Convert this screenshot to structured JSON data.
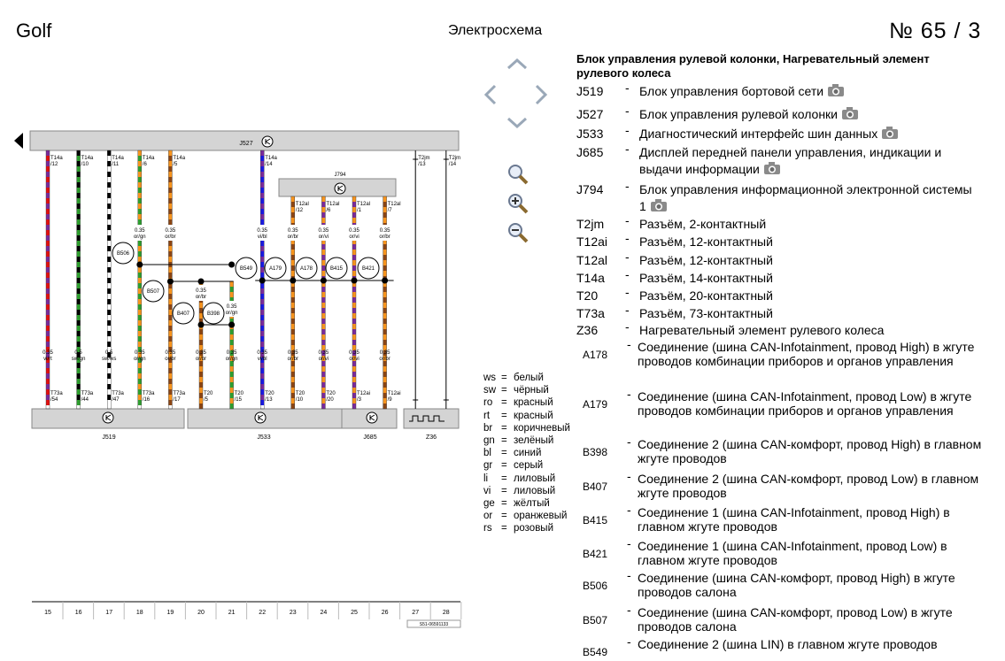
{
  "header": {
    "brand": "Golf",
    "doc_type": "Электросхема",
    "page_number": "№  65 / 3"
  },
  "title": "Блок управления рулевой колонки, Нагревательный элемент рулевого колеса",
  "components": [
    {
      "code": "J519",
      "desc": "Блок управления бортовой сети",
      "photo": true
    },
    {
      "code": "J527",
      "desc": "Блок управления рулевой колонки",
      "photo": true
    },
    {
      "code": "J533",
      "desc": "Диагностический интерфейс шин данных",
      "photo": true
    },
    {
      "code": "J685",
      "desc": "Дисплей передней панели управления, индикации и выдачи информации",
      "photo": true
    },
    {
      "code": "J794",
      "desc": "Блок управления информационной электронной системы 1",
      "photo": true
    },
    {
      "code": "T2jm",
      "desc": "Разъём, 2-контактный"
    },
    {
      "code": "T12ai",
      "desc": "Разъём, 12-контактный"
    },
    {
      "code": "T12al",
      "desc": "Разъём, 12-контактный"
    },
    {
      "code": "T14a",
      "desc": "Разъём, 14-контактный"
    },
    {
      "code": "T20",
      "desc": "Разъём, 20-контактный"
    },
    {
      "code": "T73a",
      "desc": "Разъём, 73-контактный"
    },
    {
      "code": "Z36",
      "desc": "Нагревательный элемент рулевого колеса"
    }
  ],
  "connections": [
    {
      "code": "A178",
      "desc": "Соединение (шина CAN-Infotainment, провод High) в жгуте проводов комбинации приборов и органов управления"
    },
    {
      "code": "A179",
      "desc": "Соединение (шина CAN-Infotainment, провод Low) в жгуте проводов комбинации приборов и органов управления"
    },
    {
      "code": "B398",
      "desc": "Соединение 2 (шина CAN-комфорт, провод High) в главном жгуте проводов"
    },
    {
      "code": "B407",
      "desc": "Соединение 2 (шина CAN-комфорт, провод Low) в главном жгуте проводов"
    },
    {
      "code": "B415",
      "desc": "Соединение 1 (шина CAN-Infotainment, провод High) в главном жгуте проводов"
    },
    {
      "code": "B421",
      "desc": "Соединение 1 (шина CAN-Infotainment, провод Low) в главном жгуте проводов"
    },
    {
      "code": "B506",
      "desc": "Соединение (шина CAN-комфорт, провод High) в жгуте проводов салона"
    },
    {
      "code": "B507",
      "desc": "Соединение (шина CAN-комфорт, провод Low) в жгуте проводов салона"
    },
    {
      "code": "B549",
      "desc": "Соединение 2 (шина LIN) в главном жгуте проводов"
    }
  ],
  "color_key": [
    {
      "ab": "ws",
      "name": "белый"
    },
    {
      "ab": "sw",
      "name": "чёрный"
    },
    {
      "ab": "ro",
      "name": "красный"
    },
    {
      "ab": "rt",
      "name": "красный"
    },
    {
      "ab": "br",
      "name": "коричневый"
    },
    {
      "ab": "gn",
      "name": "зелёный"
    },
    {
      "ab": "bl",
      "name": "синий"
    },
    {
      "ab": "gr",
      "name": "серый"
    },
    {
      "ab": "li",
      "name": "лиловый"
    },
    {
      "ab": "vi",
      "name": "лиловый"
    },
    {
      "ab": "ge",
      "name": "жёлтый"
    },
    {
      "ab": "or",
      "name": "оранжевый"
    },
    {
      "ab": "rs",
      "name": "розовый"
    }
  ],
  "colors": {
    "bar": "#d4d4d4",
    "orange": "#f7941d",
    "brown": "#8b4513",
    "green": "#2e9e2e",
    "violet": "#7a2a9a",
    "red": "#e01010",
    "blue": "#1a1ae0",
    "black": "#000000",
    "white": "#ffffff"
  },
  "units": {
    "J527": "J527",
    "J794": "J794",
    "J519": "J519",
    "J533": "J533",
    "J685": "J685",
    "Z36": "Z36"
  },
  "wires": [
    {
      "col": 15,
      "top": "T14a\n/12",
      "bottom": "T73a\n/54",
      "size": "0.35",
      "color": "vi/rt",
      "stripes": [
        "#7a2a9a",
        "#e01010"
      ]
    },
    {
      "col": 16,
      "top": "T14a\n/10",
      "bottom": "T73a\n/44",
      "size": "0.5",
      "color": "sw/gn",
      "stripes": [
        "#000000",
        "#2e9e2e"
      ]
    },
    {
      "col": 17,
      "top": "T14a\n/11",
      "bottom": "T73a\n/47",
      "size": "0.5",
      "color": "sw/ws",
      "stripes": [
        "#000000",
        "#ffffff"
      ]
    },
    {
      "col": 18,
      "top": "T14a\n/6",
      "bottom": "T73a\n/16",
      "size": "0.35",
      "color": "or/gn",
      "stripes": [
        "#f7941d",
        "#2e9e2e"
      ]
    },
    {
      "col": 19,
      "top": "T14a\n/5",
      "bottom": "T73a\n/17",
      "size": "0.35",
      "color": "or/br",
      "stripes": [
        "#f7941d",
        "#8b4513"
      ]
    },
    {
      "col": 20,
      "top": "",
      "bottom": "T20\n/5",
      "size": "0.35",
      "color": "or/br",
      "stripes": [
        "#f7941d",
        "#8b4513"
      ]
    },
    {
      "col": 21,
      "top": "",
      "bottom": "T20\n/15",
      "size": "0.35",
      "color": "or/gn",
      "stripes": [
        "#f7941d",
        "#2e9e2e"
      ]
    },
    {
      "col": 22,
      "top": "T14a\n/14",
      "bottom": "T20\n/13",
      "size": "0.35",
      "color": "vi/bl",
      "stripes": [
        "#7a2a9a",
        "#1a1ae0"
      ]
    },
    {
      "col": 23,
      "top": "T12al\n/12",
      "bottom": "T20\n/10",
      "size": "0.35",
      "color": "or/br",
      "stripes": [
        "#f7941d",
        "#8b4513"
      ]
    },
    {
      "col": 24,
      "top": "T12al\n/6",
      "bottom": "T20\n/20",
      "size": "0.35",
      "color": "or/vi",
      "stripes": [
        "#f7941d",
        "#7a2a9a"
      ]
    },
    {
      "col": 25,
      "top": "T12al\n/1",
      "bottom": "T12ai\n/3",
      "size": "0.35",
      "color": "or/vi",
      "stripes": [
        "#f7941d",
        "#7a2a9a"
      ]
    },
    {
      "col": 26,
      "top": "T12al\n/7",
      "bottom": "T12ai\n/9",
      "size": "0.35",
      "color": "or/br",
      "stripes": [
        "#f7941d",
        "#8b4513"
      ]
    },
    {
      "col": 27,
      "top": "T2jm\n/13",
      "bottom": "",
      "size": "",
      "color": "",
      "stripes": []
    },
    {
      "col": 28,
      "top": "T2jm\n/14",
      "bottom": "",
      "size": "",
      "color": "",
      "stripes": []
    }
  ],
  "mid_labels": [
    {
      "col": 18,
      "text": "0.35\nor/gn"
    },
    {
      "col": 19,
      "text": "0.35\nor/br"
    },
    {
      "col": 20,
      "text": "0.35\nor/br"
    },
    {
      "col": 21,
      "text": "0.35\nor/gn"
    },
    {
      "col": 22,
      "text": "0.35\nvi/bl"
    },
    {
      "col": 23,
      "text": "0.35\nor/br"
    },
    {
      "col": 24,
      "text": "0.35\nor/vi"
    },
    {
      "col": 25,
      "text": "0.35\nor/vi"
    },
    {
      "col": 26,
      "text": "0.35\nor/br"
    }
  ],
  "nodes": [
    "B506",
    "B507",
    "B407",
    "B398",
    "B549",
    "A179",
    "A178",
    "B415",
    "B421"
  ],
  "doc_id": "S51-06591133"
}
